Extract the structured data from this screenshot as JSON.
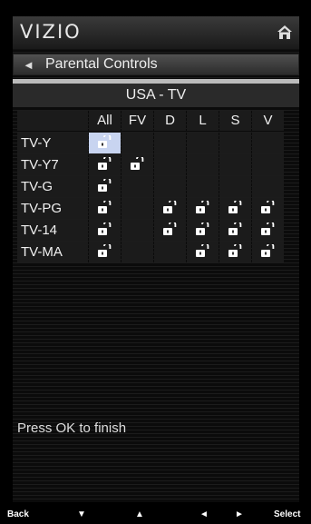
{
  "header": {
    "logo": "VIZIO",
    "home_icon": "home-icon"
  },
  "nav": {
    "back_icon": "back-arrow-icon",
    "title": "Parental Controls"
  },
  "region_label": "USA - TV",
  "columns": [
    "All",
    "FV",
    "D",
    "L",
    "S",
    "V"
  ],
  "ratings": [
    {
      "label": "TV-Y",
      "locks": [
        true,
        false,
        false,
        false,
        false,
        false
      ]
    },
    {
      "label": "TV-Y7",
      "locks": [
        true,
        true,
        false,
        false,
        false,
        false
      ]
    },
    {
      "label": "TV-G",
      "locks": [
        true,
        false,
        false,
        false,
        false,
        false
      ]
    },
    {
      "label": "TV-PG",
      "locks": [
        true,
        false,
        true,
        true,
        true,
        true
      ]
    },
    {
      "label": "TV-14",
      "locks": [
        true,
        false,
        true,
        true,
        true,
        true
      ]
    },
    {
      "label": "TV-MA",
      "locks": [
        true,
        false,
        false,
        true,
        true,
        true
      ]
    }
  ],
  "lock_state": "unlocked",
  "selected_cell": {
    "row": 0,
    "col": 0
  },
  "message": "Press OK to finish",
  "footer": {
    "back": "Back",
    "down": "▼",
    "up": "▲",
    "left": "◄",
    "right": "►",
    "select": "Select"
  },
  "colors": {
    "selected": "#c8d4f0",
    "background": "#000000"
  }
}
